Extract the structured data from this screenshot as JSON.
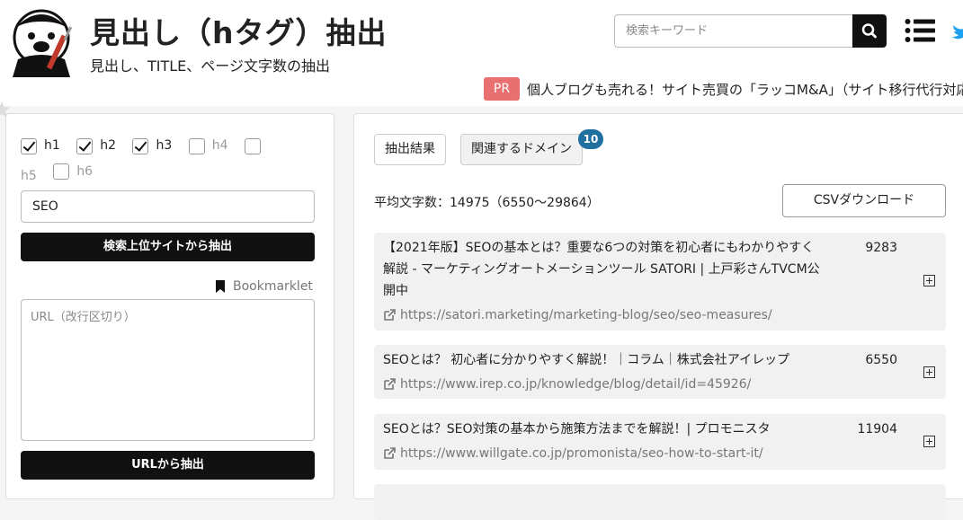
{
  "header": {
    "title": "見出し（hタグ）抽出",
    "subtitle": "見出し、TITLE、ページ文字数の抽出",
    "search_placeholder": "検索キーワード",
    "pr_badge": "PR",
    "pr_text": "個人ブログも売れる！サイト売買の「ラッコM&A」（サイト移行代行対応"
  },
  "form": {
    "checkboxes": [
      {
        "label": "h1",
        "checked": true
      },
      {
        "label": "h2",
        "checked": true
      },
      {
        "label": "h3",
        "checked": true
      },
      {
        "label": "h4",
        "checked": false
      },
      {
        "label": "h5",
        "checked": false
      },
      {
        "label": "h6",
        "checked": false
      }
    ],
    "keyword_value": "SEO",
    "extract_top_label": "検索上位サイトから抽出",
    "bookmarklet_label": "Bookmarklet",
    "url_placeholder": "URL（改行区切り）",
    "extract_url_label": "URLから抽出"
  },
  "results": {
    "tab_results": "抽出結果",
    "tab_domains": "関連するドメイン",
    "domains_count": "10",
    "average": "平均文字数：14975（6550〜29864）",
    "csv_label": "CSVダウンロード",
    "items": [
      {
        "title": "【2021年版】SEOの基本とは？重要な6つの対策を初心者にもわかりやすく解説 - マーケティングオートメーションツール SATORI | 上戸彩さんTVCM公開中",
        "count": "9283",
        "url": "https://satori.marketing/marketing-blog/seo/seo-measures/"
      },
      {
        "title": "SEOとは？ 初心者に分かりやすく解説！｜コラム｜株式会社アイレップ",
        "count": "6550",
        "url": "https://www.irep.co.jp/knowledge/blog/detail/id=45926/"
      },
      {
        "title": "SEOとは？SEO対策の基本から施策方法までを解説！| プロモニスタ",
        "count": "11904",
        "url": "https://www.willgate.co.jp/promonista/seo-how-to-start-it/"
      }
    ]
  },
  "colors": {
    "accent_dark": "#111111",
    "pr_badge": "#e87070",
    "count_badge": "#1f6f9f"
  }
}
